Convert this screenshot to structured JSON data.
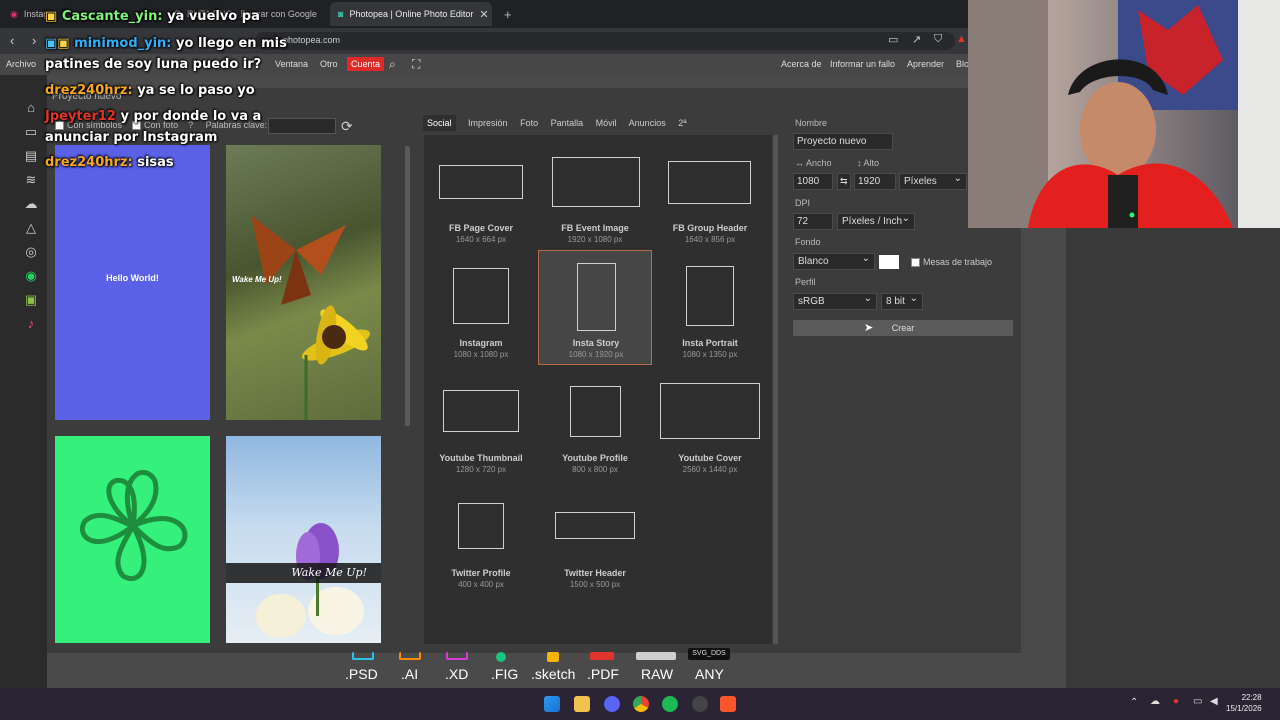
{
  "browser": {
    "tabs": [
      {
        "title": "Instagr"
      },
      {
        "title": "RUTA PNG - Buscar con Google"
      },
      {
        "title": "Photopea | Online Photo Editor"
      }
    ],
    "url": "photopea.com"
  },
  "menu": {
    "left": [
      "Archivo",
      "Ventana",
      "Otro"
    ],
    "account": "Cuenta",
    "right": [
      "Acerca de",
      "Informar un fallo",
      "Aprender",
      "Blo"
    ]
  },
  "dialog": {
    "title": "Proyecto nuevo",
    "filters": {
      "symbols": "Con símbolos",
      "photo": "Con foto",
      "help": "?",
      "keywords_label": "Palabras clave:"
    },
    "template_texts": {
      "hello": "Hello World!",
      "wake1": "Wake Me Up!",
      "wake2": "Wake Me Up!"
    },
    "tabs": [
      "Social",
      "Impresión",
      "Foto",
      "Pantalla",
      "Móvil",
      "Anuncios",
      "2ª"
    ],
    "presets": [
      {
        "name": "FB Page Cover",
        "size": "1640 x 664 px"
      },
      {
        "name": "FB Event Image",
        "size": "1920 x 1080 px"
      },
      {
        "name": "FB Group Header",
        "size": "1640 x 856 px"
      },
      {
        "name": "Instagram",
        "size": "1080 x 1080 px"
      },
      {
        "name": "Insta Story",
        "size": "1080 x 1920 px"
      },
      {
        "name": "Insta Portrait",
        "size": "1080 x 1350 px"
      },
      {
        "name": "Youtube Thumbnail",
        "size": "1280 x 720 px"
      },
      {
        "name": "Youtube Profile",
        "size": "800 x 800 px"
      },
      {
        "name": "Youtube Cover",
        "size": "2560 x 1440 px"
      },
      {
        "name": "Twitter Profile",
        "size": "400 x 400 px"
      },
      {
        "name": "Twitter Header",
        "size": "1500 x 500 px"
      }
    ],
    "form": {
      "name_label": "Nombre",
      "name_value": "Proyecto nuevo",
      "width_label": "↔ Ancho",
      "height_label": "↕ Alto",
      "width_value": "1080",
      "height_value": "1920",
      "link_icon": "⇆",
      "unit": "Píxeles",
      "dpi_label": "DPI",
      "dpi_value": "72",
      "dpi_unit": "Píxeles / Inch",
      "bg_label": "Fondo",
      "bg_value": "Blanco",
      "artboards": "Mesas de trabajo",
      "profile_label": "Perfil",
      "profile_value": "sRGB",
      "bits": "8 bit",
      "create": "Crear"
    }
  },
  "chat": [
    {
      "user": "Cascante_yin:",
      "text": "ya vuelvo pa"
    },
    {
      "user": "minimod_yin:",
      "text": "yo llego en mis"
    },
    {
      "user": "",
      "text": "patines de soy luna puedo ir?"
    },
    {
      "user": "drez240hrz:",
      "text": "ya se lo paso yo"
    },
    {
      "user": "Jpeyter12",
      "text": "y por donde lo va a"
    },
    {
      "user": "",
      "text": "anunciar por Instagram"
    },
    {
      "user": "drez240hrz:",
      "text": "sisas"
    }
  ],
  "filetypes": [
    ".PSD",
    ".AI",
    ".XD",
    ".FIG",
    ".sketch",
    ".PDF",
    "RAW",
    "ANY"
  ],
  "filetype_label": "SVG_DDS",
  "clock": {
    "time": "22:28",
    "date": "15/1/2026"
  }
}
